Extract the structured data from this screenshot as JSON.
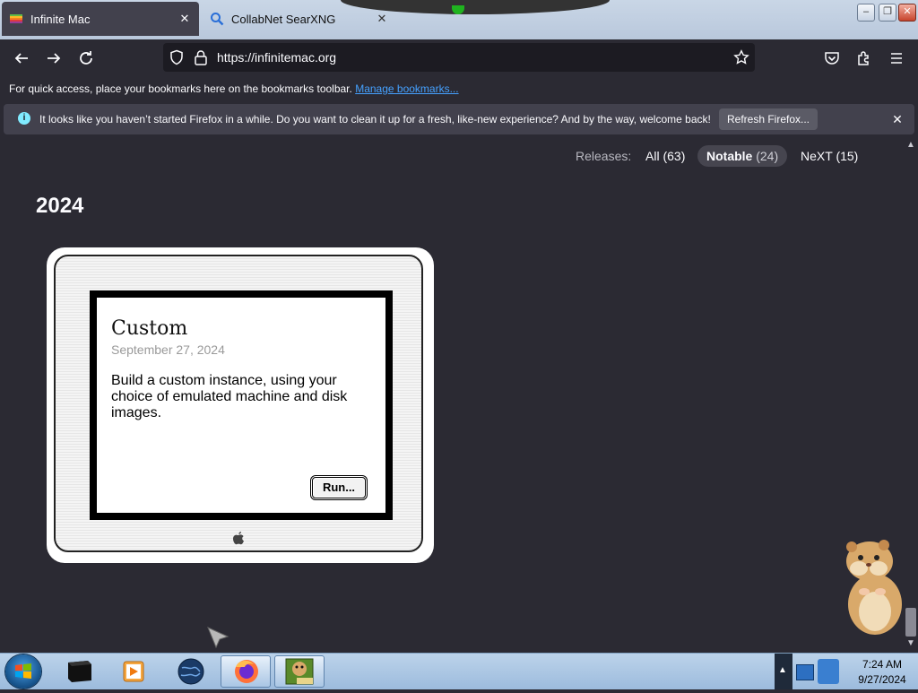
{
  "tabs": [
    {
      "title": "Infinite Mac",
      "active": true
    },
    {
      "title": "CollabNet SearXNG",
      "active": false
    }
  ],
  "navbar": {
    "url": "https://infinitemac.org"
  },
  "bookmarks_bar": {
    "text": "For quick access, place your bookmarks here on the bookmarks toolbar.",
    "link": "Manage bookmarks..."
  },
  "notification": {
    "message": "It looks like you haven’t started Firefox in a while. Do you want to clean it up for a fresh, like-new experience? And by the way, welcome back!",
    "button": "Refresh Firefox..."
  },
  "releases": {
    "label": "Releases:",
    "filters": [
      {
        "label": "All",
        "count": "(63)"
      },
      {
        "label": "Notable",
        "count": "(24)",
        "selected": true
      },
      {
        "label": "NeXT",
        "count": "(15)"
      }
    ]
  },
  "year": "2024",
  "card": {
    "title": "Custom",
    "date": "September 27, 2024",
    "description": "Build a custom instance, using your choice of emulated machine and disk images.",
    "button": "Run..."
  },
  "taskbar": {
    "time": "7:24 AM",
    "date": "9/27/2024"
  },
  "colors": {
    "page_bg": "#2b2a33",
    "link": "#45a1ff",
    "info_icon": "#80ebff"
  }
}
